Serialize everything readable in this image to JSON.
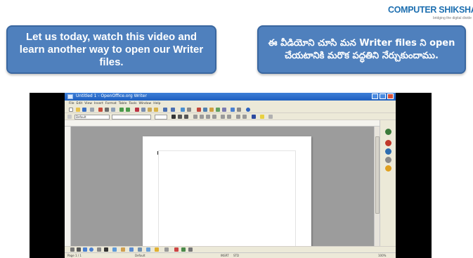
{
  "logo": {
    "name": "COMPUTER SHIKSHA",
    "tagline": "bridging the digital divide"
  },
  "banners": {
    "english": "Let us today, watch this video and learn another way to open our Writer files.",
    "telugu": "ఈ వీడియోని చూసి మన Writer files ని open చేయటానికి మరొక పద్ధతిని నేర్చుకుందాము."
  },
  "video": {
    "window_title": "Untitled 1 - OpenOffice.org Writer",
    "menu": [
      "File",
      "Edit",
      "View",
      "Insert",
      "Format",
      "Table",
      "Tools",
      "Window",
      "Help"
    ],
    "style_combo": "Default",
    "status": {
      "page": "Page 1 / 1",
      "style": "Default",
      "mode": "INSRT",
      "sel": "STD",
      "zoom": "100%"
    }
  },
  "colors": {
    "banner_bg": "#4f80bd",
    "banner_border": "#3a67a0",
    "logo_blue": "#1d6fb0",
    "titlebar": "#1f5fbf",
    "workspace_gray": "#9c9c9c"
  },
  "icons": [
    "new-document-icon",
    "open-folder-icon",
    "save-icon",
    "print-icon",
    "bold-icon",
    "italic-icon",
    "underline-icon",
    "navigator-icon",
    "gallery-icon",
    "styles-icon"
  ]
}
